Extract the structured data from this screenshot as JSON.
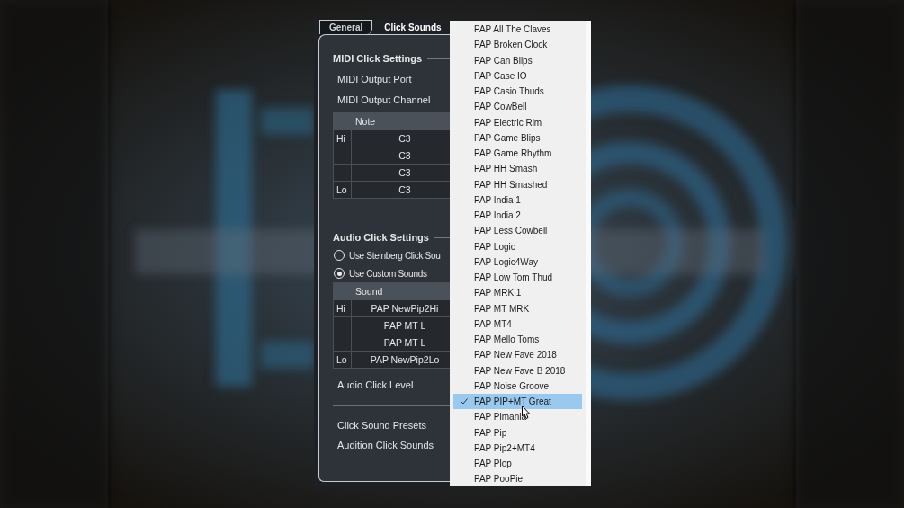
{
  "tabs": [
    {
      "label": "General",
      "selected": false
    },
    {
      "label": "Click Sounds",
      "selected": true
    }
  ],
  "midi_click": {
    "title": "MIDI Click Settings",
    "fields": [
      "MIDI Output Port",
      "MIDI Output Channel"
    ],
    "table": {
      "columns": [
        "Note"
      ],
      "rows": [
        {
          "label": "Hi",
          "value": "C3"
        },
        {
          "value": "C3"
        },
        {
          "value": "C3"
        },
        {
          "label": "Lo",
          "value": "C3"
        }
      ]
    }
  },
  "audio_click": {
    "title": "Audio Click Settings",
    "options": [
      {
        "label": "Use Steinberg Click Sou",
        "selected": false
      },
      {
        "label": "Use Custom Sounds",
        "selected": true
      }
    ],
    "table": {
      "columns": [
        "Sound"
      ],
      "rows": [
        {
          "label": "Hi",
          "value": "PAP NewPip2Hi"
        },
        {
          "value": "PAP MT L"
        },
        {
          "value": "PAP MT L"
        },
        {
          "label": "Lo",
          "value": "PAP NewPip2Lo"
        }
      ]
    },
    "level_label": "Audio Click Level"
  },
  "footer": [
    "Click Sound Presets",
    "Audition Click Sounds"
  ],
  "menu": [
    {
      "label": "PAP All The Claves",
      "selected": false
    },
    {
      "label": "PAP Broken Clock",
      "selected": false
    },
    {
      "label": "PAP Can Blips",
      "selected": false
    },
    {
      "label": "PAP Case IO",
      "selected": false
    },
    {
      "label": "PAP Casio Thuds",
      "selected": false
    },
    {
      "label": "PAP CowBell",
      "selected": false
    },
    {
      "label": "PAP Electric Rim",
      "selected": false
    },
    {
      "label": "PAP Game Blips",
      "selected": false
    },
    {
      "label": "PAP Game Rhythm",
      "selected": false
    },
    {
      "label": "PAP HH Smash",
      "selected": false
    },
    {
      "label": "PAP HH Smashed",
      "selected": false
    },
    {
      "label": "PAP India 1",
      "selected": false
    },
    {
      "label": "PAP India 2",
      "selected": false
    },
    {
      "label": "PAP Less Cowbell",
      "selected": false
    },
    {
      "label": "PAP Logic",
      "selected": false
    },
    {
      "label": "PAP Logic4Way",
      "selected": false
    },
    {
      "label": "PAP Low Tom Thud",
      "selected": false
    },
    {
      "label": "PAP MRK 1",
      "selected": false
    },
    {
      "label": "PAP MT MRK",
      "selected": false
    },
    {
      "label": "PAP MT4",
      "selected": false
    },
    {
      "label": "PAP Mello Toms",
      "selected": false
    },
    {
      "label": "PAP New Fave 2018",
      "selected": false
    },
    {
      "label": "PAP New Fave B 2018",
      "selected": false
    },
    {
      "label": "PAP Noise Groove",
      "selected": false
    },
    {
      "label": "PAP PIP+MT Great",
      "selected": true
    },
    {
      "label": "PAP Pimania",
      "selected": false
    },
    {
      "label": "PAP Pip",
      "selected": false
    },
    {
      "label": "PAP Pip2+MT4",
      "selected": false
    },
    {
      "label": "PAP Plop",
      "selected": false
    },
    {
      "label": "PAP PooPie",
      "selected": false
    }
  ]
}
